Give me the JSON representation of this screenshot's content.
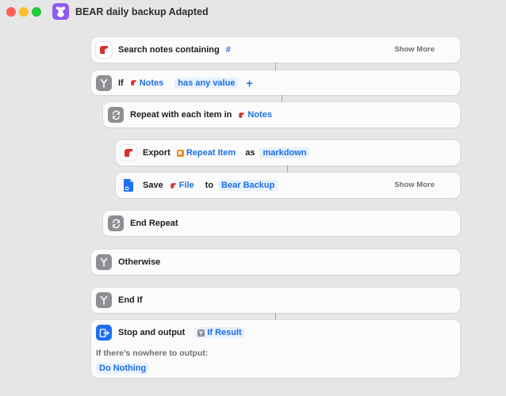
{
  "window": {
    "title": "BEAR daily backup Adapted",
    "app_icon": "teddy-bear-icon"
  },
  "actions": {
    "search": {
      "label": "Search notes containing",
      "token": "#",
      "show_more": "Show More"
    },
    "if": {
      "label": "If",
      "variable": "Notes",
      "condition": "has any value",
      "add": "+"
    },
    "repeat": {
      "label": "Repeat with each item in",
      "variable": "Notes"
    },
    "export": {
      "label": "Export",
      "variable": "Repeat Item",
      "as_label": "as",
      "format": "markdown"
    },
    "save": {
      "label": "Save",
      "variable": "File",
      "to_label": "to",
      "destination": "Bear Backup",
      "show_more": "Show More"
    },
    "end_repeat": {
      "label": "End Repeat"
    },
    "otherwise": {
      "label": "Otherwise"
    },
    "end_if": {
      "label": "End If"
    },
    "stop": {
      "label": "Stop and output",
      "variable": "If Result",
      "fallback_label": "If there’s nowhere to output:",
      "fallback_value": "Do Nothing"
    }
  },
  "colors": {
    "token_text": "#1a6fe5",
    "token_bg": "#e8f0fd",
    "bear_red": "#d6332c",
    "control_gray": "#8e8e93",
    "stop_blue": "#1f6ff2",
    "app_purple": "#8e5cf0"
  }
}
